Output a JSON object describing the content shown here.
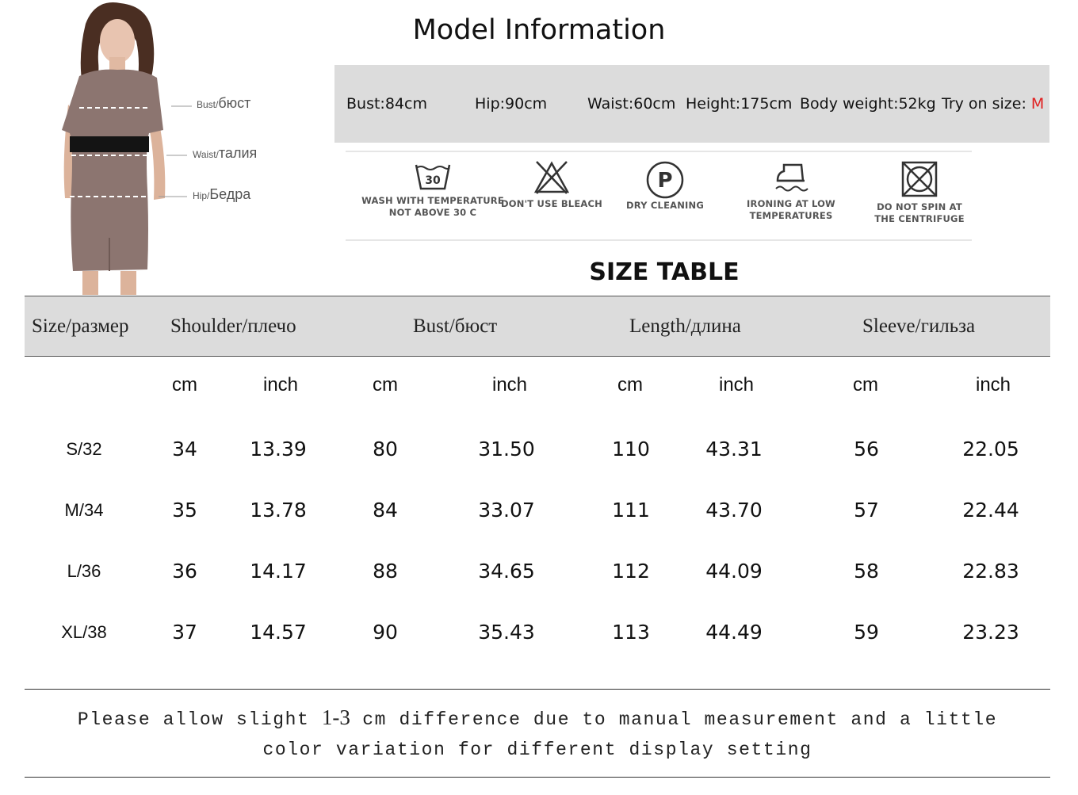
{
  "model": {
    "labels": [
      {
        "small": "Bust/",
        "large": "бюст"
      },
      {
        "small": "Waist/",
        "large": "талия"
      },
      {
        "small": "Hip/",
        "large": "Бедра"
      }
    ]
  },
  "title": "Model Information",
  "info": {
    "bust": "Bust:84cm",
    "hip": "Hip:90cm",
    "waist": "Waist:60cm",
    "height": "Height:175cm",
    "weight": "Body weight:52kg",
    "try_label": "Try on size: ",
    "try_size": "M",
    "try_size_color": "#e02020"
  },
  "care": [
    {
      "icon": "wash-30-icon",
      "number": "30",
      "line1": "WASH WITH TEMPERATURE",
      "line2": "NOT ABOVE 30 C"
    },
    {
      "icon": "no-bleach-icon",
      "line1": "DON'T USE BLEACH",
      "line2": ""
    },
    {
      "icon": "dry-clean-p-icon",
      "letter": "P",
      "line1": "DRY CLEANING",
      "line2": ""
    },
    {
      "icon": "iron-low-icon",
      "line1": "IRONING AT LOW",
      "line2": "TEMPERATURES"
    },
    {
      "icon": "no-tumble-dry-icon",
      "line1": "DO NOT SPIN AT",
      "line2": "THE CENTRIFUGE"
    }
  ],
  "size_table": {
    "title": "SIZE TABLE",
    "headers": [
      "Size/размер",
      "Shoulder/плечо",
      "Bust/бюст",
      "Length/длина",
      "Sleeve/гильза"
    ],
    "units": [
      "cm",
      "inch",
      "cm",
      "inch",
      "cm",
      "inch",
      "cm",
      "inch"
    ],
    "rows": [
      [
        "S/32",
        "34",
        "13.39",
        "80",
        "31.50",
        "110",
        "43.31",
        "56",
        "22.05"
      ],
      [
        "M/34",
        "35",
        "13.78",
        "84",
        "33.07",
        "111",
        "43.70",
        "57",
        "22.44"
      ],
      [
        "L/36",
        "36",
        "14.17",
        "88",
        "34.65",
        "112",
        "44.09",
        "58",
        "22.83"
      ],
      [
        "XL/38",
        "37",
        "14.57",
        "90",
        "35.43",
        "113",
        "44.49",
        "59",
        "23.23"
      ]
    ]
  },
  "note": {
    "before": "Please allow slight ",
    "range": "1-3",
    "after": " cm difference due to manual measurement and a little",
    "line2": "color variation for different display setting"
  },
  "colors": {
    "dress": "#8c7570",
    "header_bg": "#dcdcdc",
    "accent_red": "#e02020"
  }
}
